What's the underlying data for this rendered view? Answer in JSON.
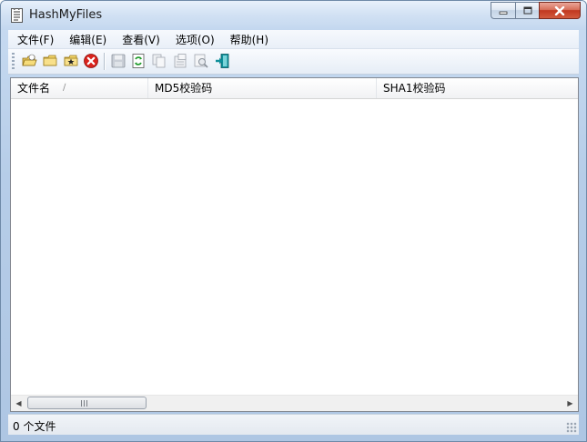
{
  "window": {
    "title": "HashMyFiles"
  },
  "menu": {
    "items": [
      {
        "label": "文件(F)"
      },
      {
        "label": "编辑(E)"
      },
      {
        "label": "查看(V)"
      },
      {
        "label": "选项(O)"
      },
      {
        "label": "帮助(H)"
      }
    ]
  },
  "toolbar": {
    "buttons": [
      {
        "icon": "open-file-icon"
      },
      {
        "icon": "open-folder-icon"
      },
      {
        "icon": "star-folder-icon"
      },
      {
        "icon": "stop-icon"
      },
      {
        "icon": "save-icon"
      },
      {
        "icon": "refresh-icon"
      },
      {
        "icon": "copy-icon"
      },
      {
        "icon": "properties-icon"
      },
      {
        "icon": "find-icon"
      },
      {
        "icon": "exit-icon"
      }
    ]
  },
  "table": {
    "columns": [
      {
        "label": "文件名"
      },
      {
        "label": "MD5校验码"
      },
      {
        "label": "SHA1校验码"
      }
    ],
    "rows": []
  },
  "status": {
    "text": "0 个文件"
  },
  "colors": {
    "accent": "#1f5fbf",
    "close_red": "#c1371f",
    "window_frame": "#b6cde8"
  }
}
